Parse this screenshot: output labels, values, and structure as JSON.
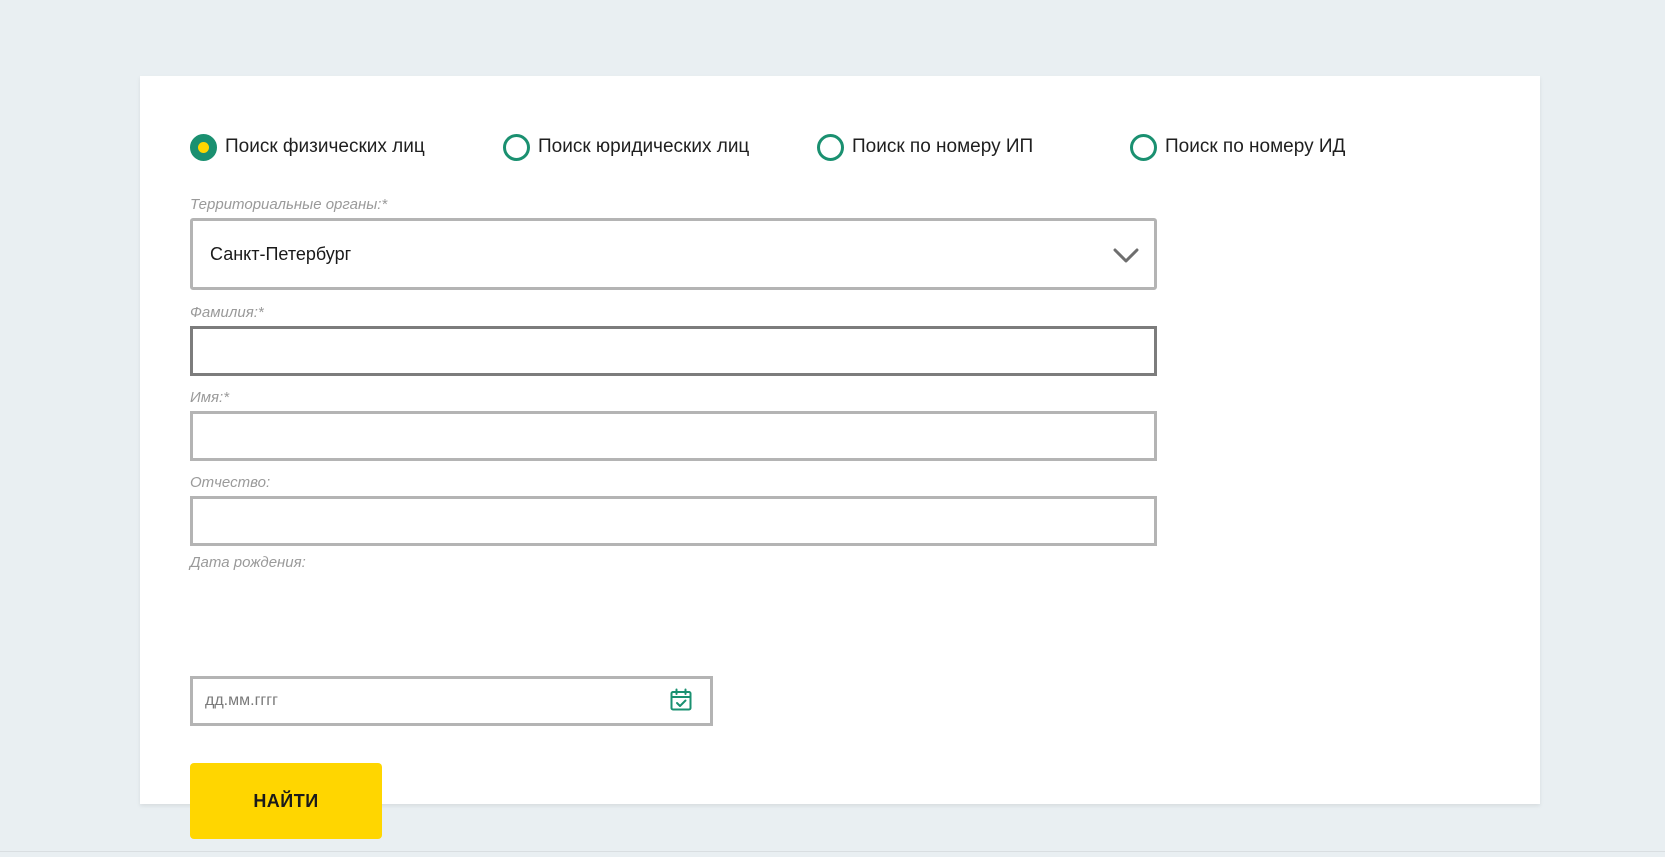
{
  "search_type": {
    "options": [
      {
        "label": "Поиск физических лиц",
        "checked": true
      },
      {
        "label": "Поиск юридических лиц",
        "checked": false
      },
      {
        "label": "Поиск по номеру ИП",
        "checked": false
      },
      {
        "label": "Поиск по номеру ИД",
        "checked": false
      }
    ]
  },
  "form": {
    "territory": {
      "label": "Территориальные органы:*",
      "value": "Санкт-Петербург",
      "icon": "chevron-down-icon"
    },
    "last_name": {
      "label": "Фамилия:*",
      "value": "",
      "placeholder": ""
    },
    "first_name": {
      "label": "Имя:*",
      "value": "",
      "placeholder": ""
    },
    "patronymic": {
      "label": "Отчество:",
      "value": "",
      "placeholder": ""
    },
    "birth_date": {
      "label": "Дата рождения:",
      "value": "",
      "placeholder": "дд.мм.гггг",
      "icon": "calendar-icon"
    },
    "submit_label": "НАЙТИ"
  },
  "colors": {
    "accent_green": "#1a9070",
    "accent_yellow": "#ffd600",
    "page_background": "#e9eff2",
    "border": "#b4b4b4"
  }
}
